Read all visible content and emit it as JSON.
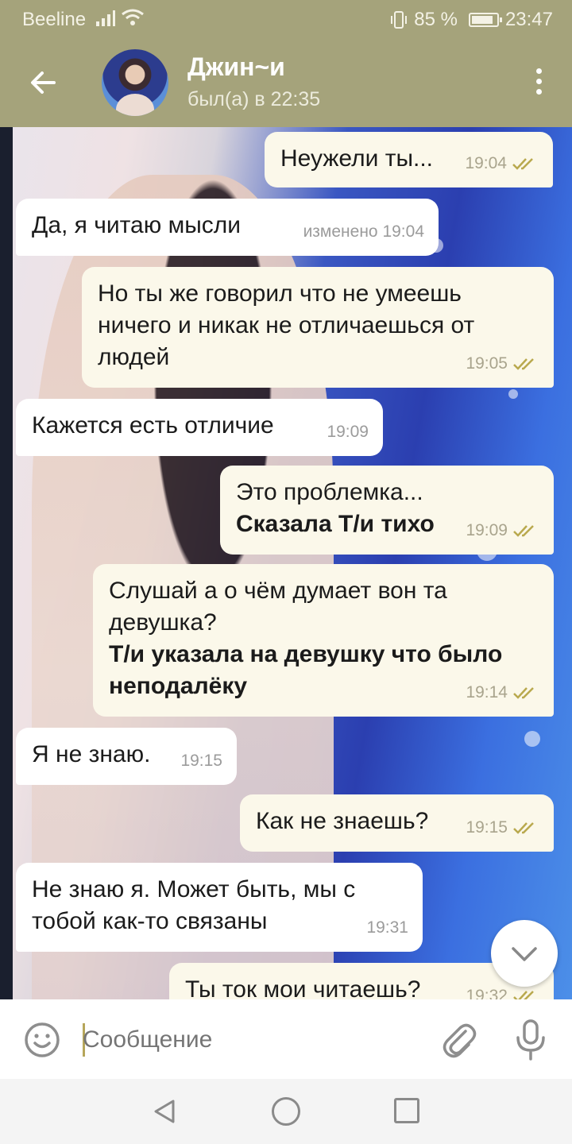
{
  "status_bar": {
    "carrier": "Beeline",
    "battery_percent": "85 %",
    "battery_level": 0.85,
    "time": "23:47"
  },
  "header": {
    "title": "Джин~и",
    "status": "был(а) в 22:35"
  },
  "messages": [
    {
      "direction": "out",
      "text": "Неужели ты...",
      "time": "19:04",
      "read": true
    },
    {
      "direction": "in",
      "text": "Да, я читаю мысли",
      "time": "изменено 19:04"
    },
    {
      "direction": "out",
      "text": "Но ты же говорил что не умеешь ничего и никак не отличаешься от людей",
      "time": "19:05",
      "read": true
    },
    {
      "direction": "in",
      "text": "Кажется есть отличие",
      "time": "19:09"
    },
    {
      "direction": "out",
      "text": "Это проблемка...",
      "bold": "Сказала Т/и тихо",
      "time": "19:09",
      "read": true
    },
    {
      "direction": "out",
      "text": "Слушай а о чём думает вон та девушка?",
      "bold": "Т/и указала на девушку что было неподалёку",
      "time": "19:14",
      "read": true
    },
    {
      "direction": "in",
      "text": "Я не знаю.",
      "time": "19:15"
    },
    {
      "direction": "out",
      "text": "Как не знаешь?",
      "time": "19:15",
      "read": true
    },
    {
      "direction": "in",
      "text": "Не знаю я. Может быть, мы с тобой как-то связаны",
      "time": "19:31"
    },
    {
      "direction": "out",
      "text": "Ты ток мои читаешь?",
      "time": "19:32",
      "read": true
    }
  ],
  "composer": {
    "placeholder": "Сообщение"
  },
  "icons": {
    "back": "arrow-left-icon",
    "menu": "more-vertical-icon",
    "emoji": "smiley-icon",
    "attach": "paperclip-icon",
    "mic": "microphone-icon",
    "scroll_down": "chevron-down-icon"
  },
  "colors": {
    "header": "#a5a37b",
    "outgoing_bubble": "#fbf8ea",
    "incoming_bubble": "#ffffff",
    "read_check": "#b9a94e"
  }
}
